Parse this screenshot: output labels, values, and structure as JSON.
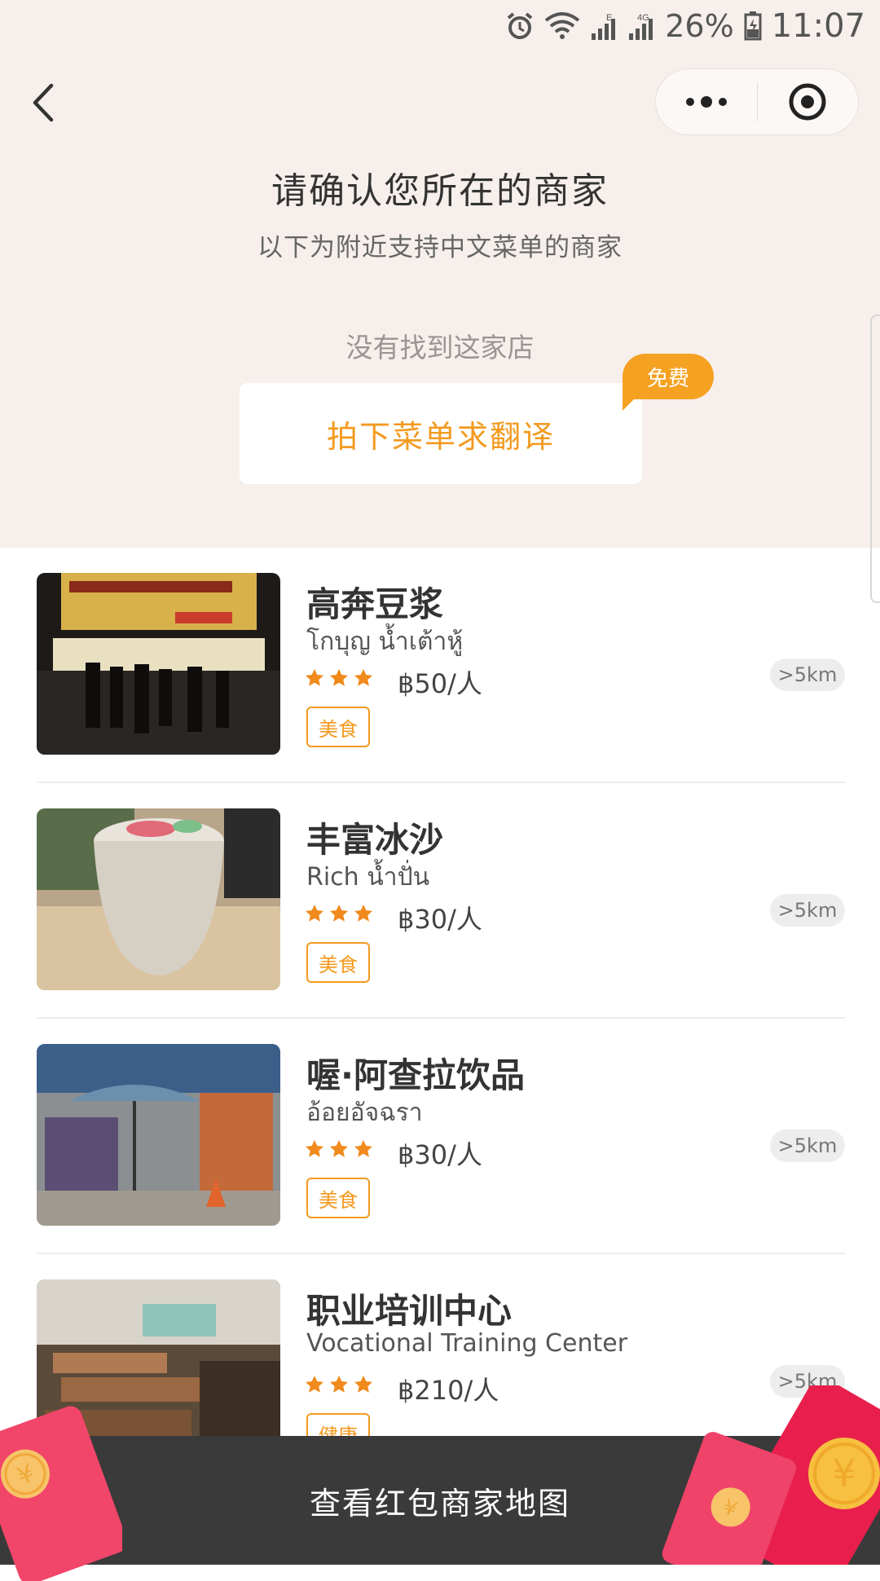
{
  "status": {
    "battery_percent": "26%",
    "time": "11:07",
    "network_small": "E",
    "network_4g": "4G"
  },
  "nav": {
    "back_icon": "chevron-left-icon",
    "more_icon": "more-dots-icon",
    "target_icon": "target-icon"
  },
  "header": {
    "title": "请确认您所在的商家",
    "subtitle": "以下为附近支持中文菜单的商家",
    "not_found": "没有找到这家店",
    "photo_button": "拍下菜单求翻译",
    "free_badge": "免费"
  },
  "merchants": [
    {
      "name": "高奔豆浆",
      "local_name": "โกบุญ น้ำเต้าหู้",
      "price": "฿50/人",
      "tag": "美食",
      "distance": ">5km",
      "rating": 3
    },
    {
      "name": "丰富冰沙",
      "local_name": "Rich น้ำปั่น",
      "price": "฿30/人",
      "tag": "美食",
      "distance": ">5km",
      "rating": 3
    },
    {
      "name": "喔·阿查拉饮品",
      "local_name": "อ้อยอัจฉรา",
      "price": "฿30/人",
      "tag": "美食",
      "distance": ">5km",
      "rating": 3
    },
    {
      "name": "职业培训中心",
      "local_name": "Vocational Training Center",
      "price": "฿210/人",
      "tag": "健康",
      "distance": ">5km",
      "rating": 3
    }
  ],
  "bottom_bar": {
    "label": "查看红包商家地图"
  },
  "colors": {
    "accent": "#f39a1f",
    "header_bg": "#f6efec",
    "bottom_bar": "#3a3a3a",
    "red_packet": "#f5315a"
  }
}
